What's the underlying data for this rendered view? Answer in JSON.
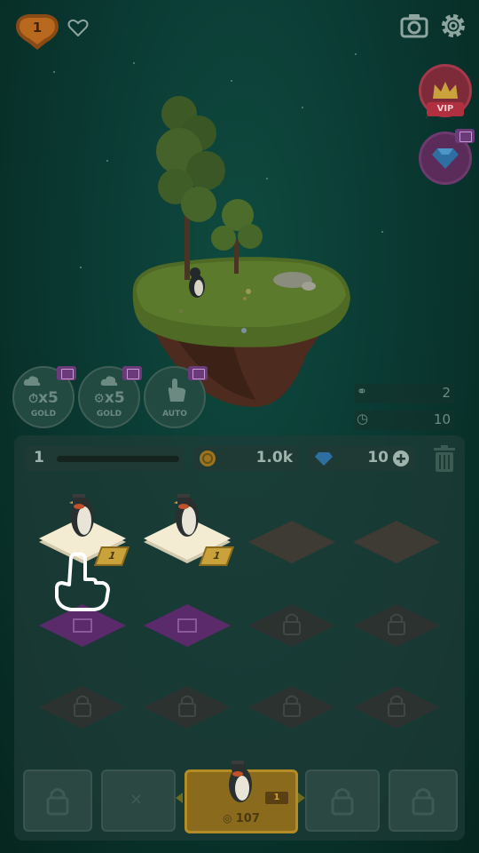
{
  "header": {
    "level": "1"
  },
  "boosts": [
    {
      "label": "x5",
      "sub": "GOLD"
    },
    {
      "label": "x5",
      "sub": "GOLD"
    },
    {
      "label": "",
      "sub": "AUTO"
    }
  ],
  "vip_label": "VIP",
  "stats": {
    "visitors": "2",
    "timer": "10"
  },
  "panel": {
    "level": "1",
    "level_progress": 0.0,
    "coins": "1.0k",
    "gems": "10"
  },
  "grid": {
    "row1": [
      {
        "type": "penguin",
        "level": "1"
      },
      {
        "type": "penguin",
        "level": "1"
      },
      {
        "type": "empty"
      },
      {
        "type": "empty"
      }
    ],
    "row2": [
      {
        "type": "video"
      },
      {
        "type": "video"
      },
      {
        "type": "locked"
      },
      {
        "type": "locked"
      }
    ],
    "row3": [
      {
        "type": "locked"
      },
      {
        "type": "locked"
      },
      {
        "type": "locked"
      },
      {
        "type": "locked"
      }
    ]
  },
  "shop": {
    "featured_level": "1",
    "featured_price": "107"
  },
  "colors": {
    "tile_light": "#f4ecd2",
    "tile_gold": "#d4a32a",
    "tile_video": "#5a2a6a",
    "tile_dark": "#3e3a34"
  }
}
